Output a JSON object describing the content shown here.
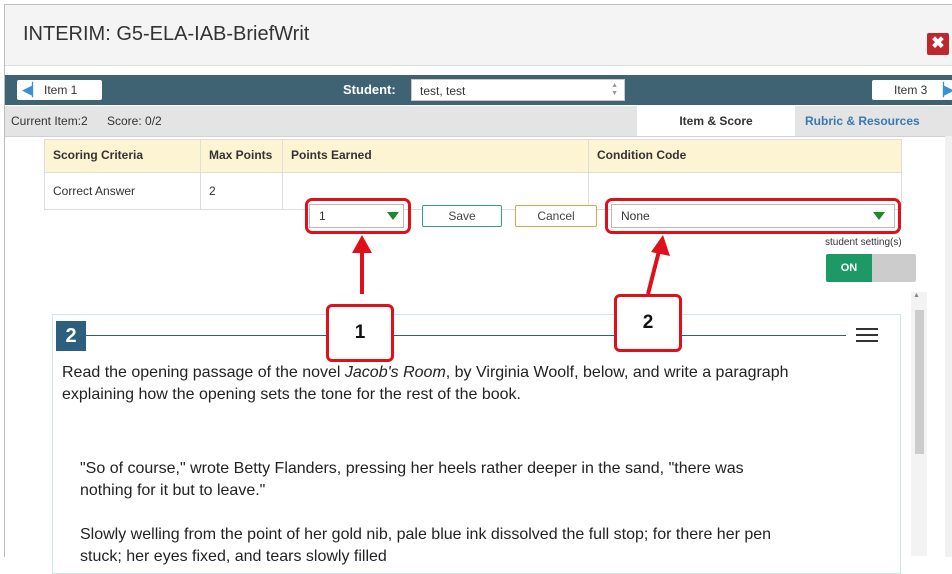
{
  "window": {
    "title": "INTERIM: G5-ELA-IAB-BriefWrit",
    "close_glyph": "✖"
  },
  "nav": {
    "prev_label": "Item 1",
    "next_label": "Item 3",
    "student_label": "Student:",
    "student_value": "test, test"
  },
  "info": {
    "current_item": "Current Item:2",
    "score": "Score: 0/2",
    "tabs": [
      "Item & Score",
      "Rubric & Resources"
    ]
  },
  "table": {
    "headers": [
      "Scoring Criteria",
      "Max Points",
      "Points Earned",
      "Condition Code"
    ],
    "row": {
      "criteria": "Correct Answer",
      "max_points": "2",
      "points_earned": "1",
      "condition_code": "None"
    },
    "save_label": "Save",
    "cancel_label": "Cancel"
  },
  "student_setting": {
    "label": "student setting(s)",
    "state": "ON"
  },
  "callouts": [
    "1",
    "2"
  ],
  "item": {
    "number": "2",
    "prompt_before": "Read the opening passage of the novel ",
    "prompt_title": "Jacob's Room",
    "prompt_after": ", by Virginia Woolf, below, and write a paragraph explaining how the opening sets the tone for the rest of the book.",
    "quote1": "\"So of course,\" wrote Betty Flanders, pressing her heels rather deeper in the sand, \"there was nothing for it but to leave.\"",
    "quote2": "Slowly welling from the point of her gold nib, pale blue ink dissolved the full stop; for there her pen stuck; her eyes fixed, and tears slowly filled"
  },
  "colors": {
    "nav_bg": "#3f6373",
    "header_bg": "#fdf4d3",
    "accent_red": "#e0101b",
    "toggle_on": "#1d9965"
  }
}
